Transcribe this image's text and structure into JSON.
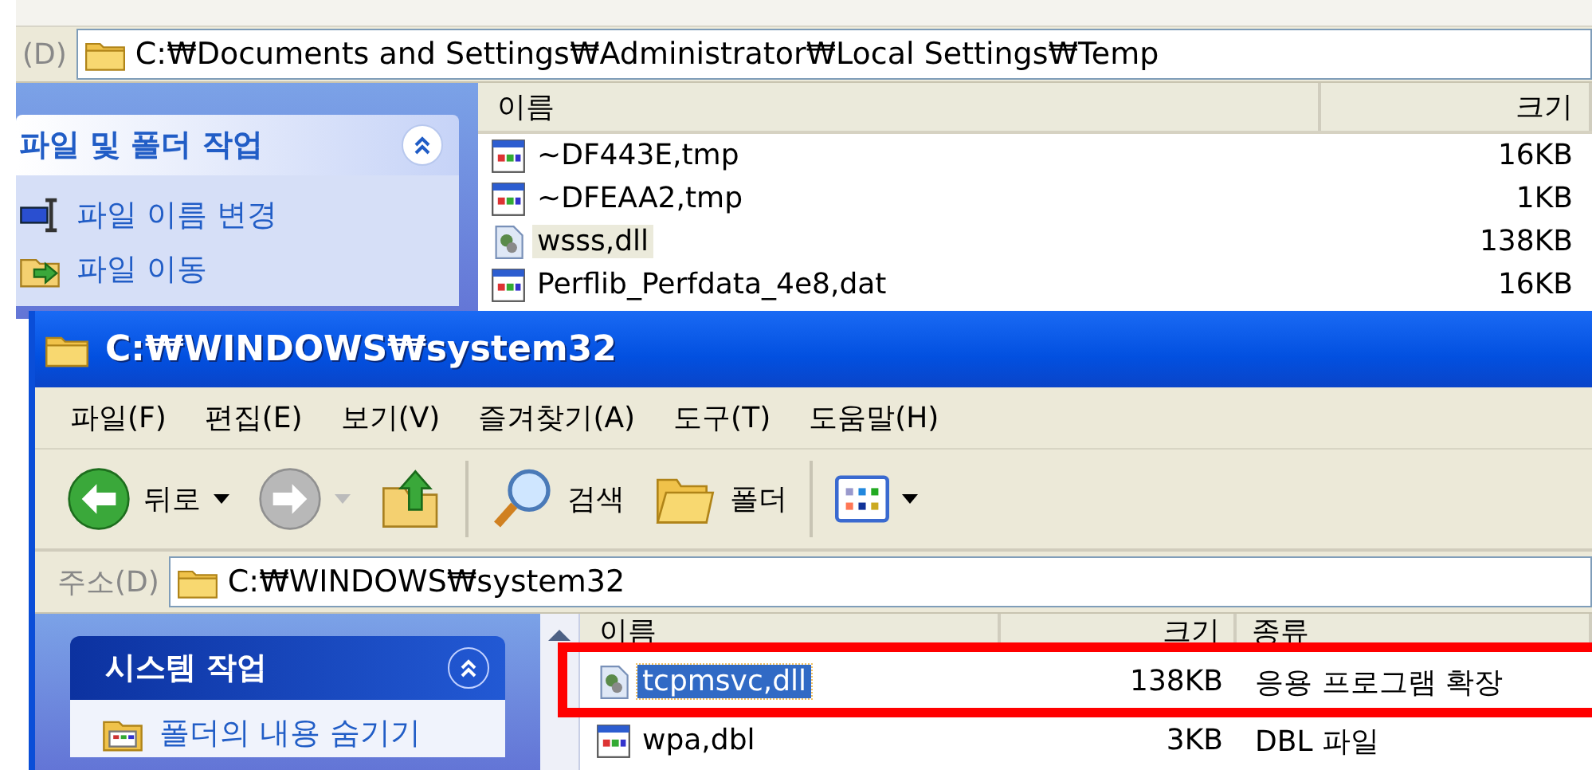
{
  "back_window": {
    "address": {
      "label": "(D)",
      "path": "C:₩Documents and Settings₩Administrator₩Local Settings₩Temp"
    },
    "task_panel": {
      "title": "파일 및 폴더 작업",
      "expanded": true,
      "items": [
        {
          "label": "파일 이름 변경",
          "kind": "rename"
        },
        {
          "label": "파일 이동",
          "kind": "move"
        }
      ]
    },
    "file_list": {
      "columns": [
        "이름",
        "크기"
      ],
      "rows": [
        {
          "name": "~DF443E,tmp",
          "size": "16KB",
          "kind": "document",
          "selected": false
        },
        {
          "name": "~DFEAA2,tmp",
          "size": "1KB",
          "kind": "document",
          "selected": false
        },
        {
          "name": "wsss,dll",
          "size": "138KB",
          "kind": "extension",
          "selected": true
        },
        {
          "name": "Perflib_Perfdata_4e8,dat",
          "size": "16KB",
          "kind": "document",
          "selected": false
        }
      ]
    }
  },
  "front_window": {
    "title": "C:₩WINDOWS₩system32",
    "active": true,
    "menu": [
      "파일(F)",
      "편집(E)",
      "보기(V)",
      "즐겨찾기(A)",
      "도구(T)",
      "도움말(H)"
    ],
    "toolbar": [
      {
        "kind": "back",
        "label": "뒤로",
        "dropdown": true
      },
      {
        "kind": "forward",
        "dropdown": true
      },
      {
        "kind": "up"
      },
      {
        "kind": "separator"
      },
      {
        "kind": "search",
        "label": "검색"
      },
      {
        "kind": "folders",
        "label": "폴더"
      },
      {
        "kind": "separator"
      },
      {
        "kind": "views",
        "dropdown": true
      }
    ],
    "address": {
      "label": "주소(D)",
      "path": "C:₩WINDOWS₩system32"
    },
    "task_panel": {
      "title": "시스템 작업",
      "expanded": true,
      "items": [
        {
          "label": "폴더의 내용 숨기기",
          "kind": "hide"
        }
      ]
    },
    "file_list": {
      "columns": [
        "이름",
        "크기",
        "종류"
      ],
      "rows": [
        {
          "name": "tcpmsvc,dll",
          "size": "138KB",
          "type": "응용 프로그램 확장",
          "kind": "extension",
          "selected": true,
          "marked": true
        },
        {
          "name": "wpa,dbl",
          "size": "3KB",
          "type": "DBL 파일",
          "kind": "document",
          "selected": false,
          "marked": false
        }
      ]
    }
  }
}
